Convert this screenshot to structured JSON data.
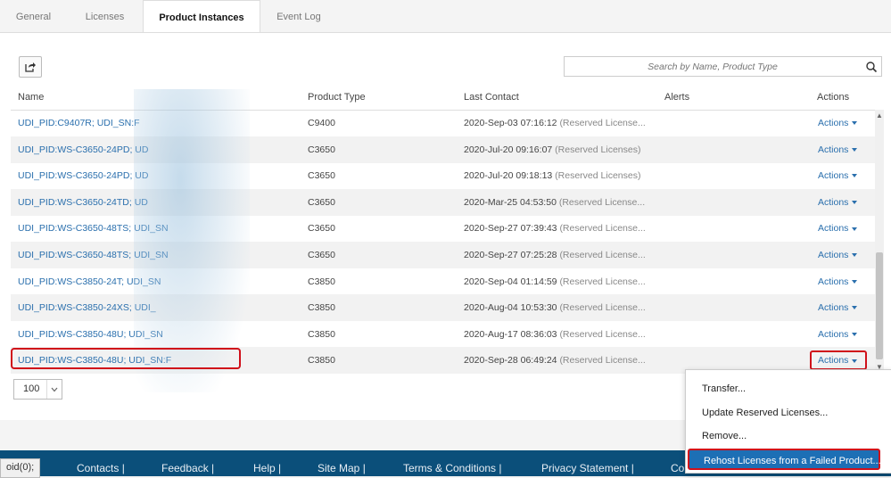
{
  "tabs": [
    "General",
    "Licenses",
    "Product Instances",
    "Event Log"
  ],
  "active_tab": "Product Instances",
  "search": {
    "placeholder": "Search by Name, Product Type"
  },
  "table": {
    "columns": [
      "Name",
      "Product Type",
      "Last Contact",
      "Alerts",
      "Actions"
    ],
    "rows": [
      {
        "name": "UDI_PID:C9407R; UDI_SN:F",
        "type": "C9400",
        "date": "2020-Sep-03 07:16:12",
        "status": "(Reserved License...",
        "actions": "Actions"
      },
      {
        "name": "UDI_PID:WS-C3650-24PD; UD",
        "type": "C3650",
        "date": "2020-Jul-20 09:16:07",
        "status": "(Reserved Licenses)",
        "actions": "Actions"
      },
      {
        "name": "UDI_PID:WS-C3650-24PD; UD",
        "type": "C3650",
        "date": "2020-Jul-20 09:18:13",
        "status": "(Reserved Licenses)",
        "actions": "Actions"
      },
      {
        "name": "UDI_PID:WS-C3650-24TD; UD",
        "type": "C3650",
        "date": "2020-Mar-25 04:53:50",
        "status": "(Reserved License...",
        "actions": "Actions"
      },
      {
        "name": "UDI_PID:WS-C3650-48TS; UDI_SN",
        "type": "C3650",
        "date": "2020-Sep-27 07:39:43",
        "status": "(Reserved License...",
        "actions": "Actions"
      },
      {
        "name": "UDI_PID:WS-C3650-48TS; UDI_SN",
        "type": "C3650",
        "date": "2020-Sep-27 07:25:28",
        "status": "(Reserved License...",
        "actions": "Actions"
      },
      {
        "name": "UDI_PID:WS-C3850-24T; UDI_SN",
        "type": "C3850",
        "date": "2020-Sep-04 01:14:59",
        "status": "(Reserved License...",
        "actions": "Actions"
      },
      {
        "name": "UDI_PID:WS-C3850-24XS; UDI_",
        "type": "C3850",
        "date": "2020-Aug-04 10:53:30",
        "status": "(Reserved License...",
        "actions": "Actions"
      },
      {
        "name": "UDI_PID:WS-C3850-48U; UDI_SN",
        "type": "C3850",
        "date": "2020-Aug-17 08:36:03",
        "status": "(Reserved License...",
        "actions": "Actions"
      },
      {
        "name": "UDI_PID:WS-C3850-48U; UDI_SN:F",
        "type": "C3850",
        "date": "2020-Sep-28 06:49:24",
        "status": "(Reserved License...",
        "actions": "Actions"
      }
    ]
  },
  "pagination": {
    "page_size": "100"
  },
  "dropdown_menu": {
    "items": [
      "Transfer...",
      "Update Reserved Licenses...",
      "Remove...",
      "Rehost Licenses from a Failed Product..."
    ],
    "selected": "Rehost Licenses from a Failed Product..."
  },
  "footer": {
    "links": [
      "Contacts |",
      "Feedback |",
      "Help |",
      "Site Map |",
      "Terms & Conditions |",
      "Privacy Statement |",
      "Co"
    ]
  },
  "status_bar": {
    "url": "oid(0);"
  },
  "colors": {
    "link": "#2a6fad",
    "highlight": "#d0101a",
    "footer": "#0b4f7a",
    "menu_selected": "#1d6fb5"
  }
}
